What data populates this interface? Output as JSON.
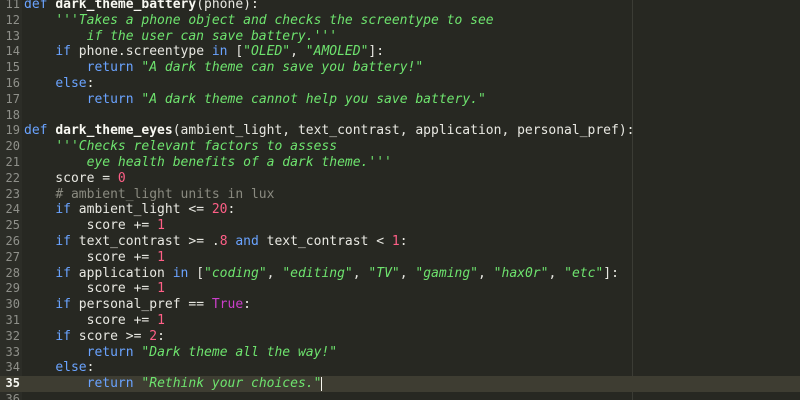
{
  "colors": {
    "background": "#272822",
    "current_line": "#3e3d32",
    "keyword": "#6aa3ff",
    "string": "#6ee36e",
    "number": "#ff5f87",
    "comment": "#8a8a80",
    "boolean": "#cb3fcb",
    "text": "#e8e8e2",
    "line_number": "#8f908a"
  },
  "editor": {
    "current_line_number": 35,
    "lines": [
      {
        "n": "11",
        "tokens": [
          {
            "t": "kw",
            "v": "def"
          },
          {
            "t": "plain",
            "v": " "
          },
          {
            "t": "fn",
            "v": "dark_theme_battery"
          },
          {
            "t": "plain",
            "v": "(phone):"
          }
        ]
      },
      {
        "n": "12",
        "tokens": [
          {
            "t": "plain",
            "v": "    "
          },
          {
            "t": "str",
            "v": "'''Takes a phone object and checks the screentype to see"
          }
        ]
      },
      {
        "n": "13",
        "tokens": [
          {
            "t": "str",
            "v": "        if the user can save battery.'''"
          }
        ]
      },
      {
        "n": "14",
        "tokens": [
          {
            "t": "plain",
            "v": "    "
          },
          {
            "t": "kw",
            "v": "if"
          },
          {
            "t": "plain",
            "v": " phone.screentype "
          },
          {
            "t": "kw",
            "v": "in"
          },
          {
            "t": "plain",
            "v": " ["
          },
          {
            "t": "str",
            "v": "\"OLED\""
          },
          {
            "t": "plain",
            "v": ", "
          },
          {
            "t": "str",
            "v": "\"AMOLED\""
          },
          {
            "t": "plain",
            "v": "]:"
          }
        ]
      },
      {
        "n": "15",
        "tokens": [
          {
            "t": "plain",
            "v": "        "
          },
          {
            "t": "kw",
            "v": "return"
          },
          {
            "t": "plain",
            "v": " "
          },
          {
            "t": "str",
            "v": "\"A dark theme can save you battery!\""
          }
        ]
      },
      {
        "n": "16",
        "tokens": [
          {
            "t": "plain",
            "v": "    "
          },
          {
            "t": "kw",
            "v": "else"
          },
          {
            "t": "plain",
            "v": ":"
          }
        ]
      },
      {
        "n": "17",
        "tokens": [
          {
            "t": "plain",
            "v": "        "
          },
          {
            "t": "kw",
            "v": "return"
          },
          {
            "t": "plain",
            "v": " "
          },
          {
            "t": "str",
            "v": "\"A dark theme cannot help you save battery.\""
          }
        ]
      },
      {
        "n": "18",
        "tokens": []
      },
      {
        "n": "19",
        "tokens": [
          {
            "t": "kw",
            "v": "def"
          },
          {
            "t": "plain",
            "v": " "
          },
          {
            "t": "fn",
            "v": "dark_theme_eyes"
          },
          {
            "t": "plain",
            "v": "(ambient_light, text_contrast, application, personal_pref):"
          }
        ]
      },
      {
        "n": "20",
        "tokens": [
          {
            "t": "plain",
            "v": "    "
          },
          {
            "t": "str",
            "v": "'''Checks relevant factors to assess"
          }
        ]
      },
      {
        "n": "21",
        "tokens": [
          {
            "t": "str",
            "v": "        eye health benefits of a dark theme.'''"
          }
        ]
      },
      {
        "n": "22",
        "tokens": [
          {
            "t": "plain",
            "v": "    score = "
          },
          {
            "t": "num",
            "v": "0"
          }
        ]
      },
      {
        "n": "23",
        "tokens": [
          {
            "t": "plain",
            "v": "    "
          },
          {
            "t": "cm",
            "v": "# ambient_light units in lux"
          }
        ]
      },
      {
        "n": "24",
        "tokens": [
          {
            "t": "plain",
            "v": "    "
          },
          {
            "t": "kw",
            "v": "if"
          },
          {
            "t": "plain",
            "v": " ambient_light <= "
          },
          {
            "t": "num",
            "v": "20"
          },
          {
            "t": "plain",
            "v": ":"
          }
        ]
      },
      {
        "n": "25",
        "tokens": [
          {
            "t": "plain",
            "v": "        score += "
          },
          {
            "t": "num",
            "v": "1"
          }
        ]
      },
      {
        "n": "26",
        "tokens": [
          {
            "t": "plain",
            "v": "    "
          },
          {
            "t": "kw",
            "v": "if"
          },
          {
            "t": "plain",
            "v": " text_contrast >= ."
          },
          {
            "t": "num",
            "v": "8"
          },
          {
            "t": "plain",
            "v": " "
          },
          {
            "t": "kw",
            "v": "and"
          },
          {
            "t": "plain",
            "v": " text_contrast < "
          },
          {
            "t": "num",
            "v": "1"
          },
          {
            "t": "plain",
            "v": ":"
          }
        ]
      },
      {
        "n": "27",
        "tokens": [
          {
            "t": "plain",
            "v": "        score += "
          },
          {
            "t": "num",
            "v": "1"
          }
        ]
      },
      {
        "n": "28",
        "tokens": [
          {
            "t": "plain",
            "v": "    "
          },
          {
            "t": "kw",
            "v": "if"
          },
          {
            "t": "plain",
            "v": " application "
          },
          {
            "t": "kw",
            "v": "in"
          },
          {
            "t": "plain",
            "v": " ["
          },
          {
            "t": "str",
            "v": "\"coding\""
          },
          {
            "t": "plain",
            "v": ", "
          },
          {
            "t": "str",
            "v": "\"editing\""
          },
          {
            "t": "plain",
            "v": ", "
          },
          {
            "t": "str",
            "v": "\"TV\""
          },
          {
            "t": "plain",
            "v": ", "
          },
          {
            "t": "str",
            "v": "\"gaming\""
          },
          {
            "t": "plain",
            "v": ", "
          },
          {
            "t": "str",
            "v": "\"hax0r\""
          },
          {
            "t": "plain",
            "v": ", "
          },
          {
            "t": "str",
            "v": "\"etc\""
          },
          {
            "t": "plain",
            "v": "]:"
          }
        ]
      },
      {
        "n": "29",
        "tokens": [
          {
            "t": "plain",
            "v": "        score += "
          },
          {
            "t": "num",
            "v": "1"
          }
        ]
      },
      {
        "n": "30",
        "tokens": [
          {
            "t": "plain",
            "v": "    "
          },
          {
            "t": "kw",
            "v": "if"
          },
          {
            "t": "plain",
            "v": " personal_pref == "
          },
          {
            "t": "bool",
            "v": "True"
          },
          {
            "t": "plain",
            "v": ":"
          }
        ]
      },
      {
        "n": "31",
        "tokens": [
          {
            "t": "plain",
            "v": "        score += "
          },
          {
            "t": "num",
            "v": "1"
          }
        ]
      },
      {
        "n": "32",
        "tokens": [
          {
            "t": "plain",
            "v": "    "
          },
          {
            "t": "kw",
            "v": "if"
          },
          {
            "t": "plain",
            "v": " score >= "
          },
          {
            "t": "num",
            "v": "2"
          },
          {
            "t": "plain",
            "v": ":"
          }
        ]
      },
      {
        "n": "33",
        "tokens": [
          {
            "t": "plain",
            "v": "        "
          },
          {
            "t": "kw",
            "v": "return"
          },
          {
            "t": "plain",
            "v": " "
          },
          {
            "t": "str",
            "v": "\"Dark theme all the way!\""
          }
        ]
      },
      {
        "n": "34",
        "tokens": [
          {
            "t": "plain",
            "v": "    "
          },
          {
            "t": "kw",
            "v": "else"
          },
          {
            "t": "plain",
            "v": ":"
          }
        ]
      },
      {
        "n": "35",
        "tokens": [
          {
            "t": "plain",
            "v": "        "
          },
          {
            "t": "kw",
            "v": "return"
          },
          {
            "t": "plain",
            "v": " "
          },
          {
            "t": "str",
            "v": "\"Rethink your choices.\""
          }
        ]
      },
      {
        "n": "36",
        "tokens": []
      }
    ]
  }
}
